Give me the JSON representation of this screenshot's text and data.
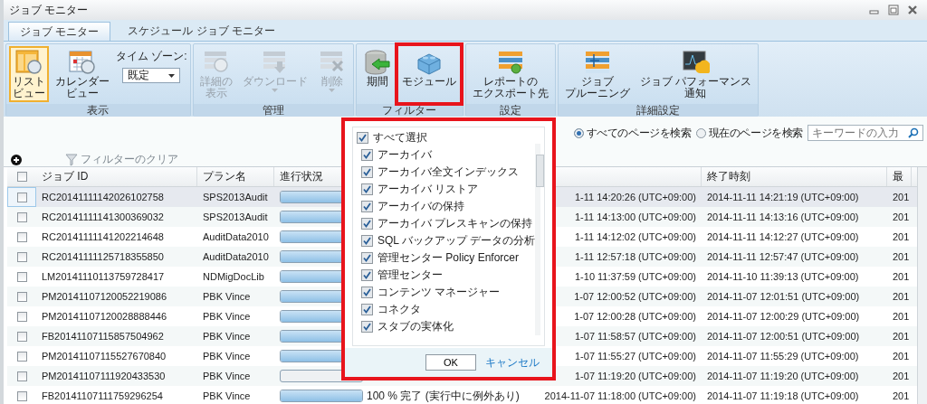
{
  "window": {
    "title": "ジョブ モニター"
  },
  "tabs": [
    {
      "label": "ジョブ モニター",
      "selected": true
    },
    {
      "label": "スケジュール ジョブ モニター",
      "selected": false
    }
  ],
  "ribbon": {
    "groups": [
      {
        "label": "表示",
        "items": [
          {
            "kind": "list-view",
            "lines": [
              "リスト",
              "ビュー"
            ],
            "selected": true
          },
          {
            "kind": "calendar-view",
            "lines": [
              "カレンダー",
              "ビュー"
            ],
            "selected": false
          },
          {
            "kind": "timezone",
            "label": "タイム ゾーン:",
            "value": "既定"
          }
        ]
      },
      {
        "label": "管理",
        "items": [
          {
            "kind": "details",
            "lines": [
              "詳細の",
              "表示"
            ],
            "disabled": true
          },
          {
            "kind": "download",
            "lines": [
              "ダウンロード"
            ],
            "disabled": true,
            "dropdown": true
          },
          {
            "kind": "delete",
            "lines": [
              "削除"
            ],
            "disabled": true,
            "dropdown": true
          }
        ]
      },
      {
        "label": "フィルター",
        "items": [
          {
            "kind": "period",
            "lines": [
              "期間"
            ],
            "disabled": false
          },
          {
            "kind": "module",
            "lines": [
              "モジュール"
            ],
            "disabled": false,
            "highlighted": true
          }
        ]
      },
      {
        "label": "設定",
        "items": [
          {
            "kind": "report-export",
            "lines": [
              "レポートの",
              "エクスポート先"
            ],
            "disabled": false
          }
        ]
      },
      {
        "label": "詳細設定",
        "items": [
          {
            "kind": "pruning",
            "lines": [
              "ジョブ",
              "プルーニング"
            ],
            "disabled": false
          },
          {
            "kind": "perf-notify",
            "lines": [
              "ジョブ パフォーマンス",
              "通知"
            ],
            "disabled": false
          }
        ]
      }
    ]
  },
  "search": {
    "scopes": [
      {
        "label": "すべてのページを検索",
        "selected": true
      },
      {
        "label": "現在のページを検索",
        "selected": false
      }
    ],
    "placeholder": "キーワードの入力"
  },
  "filter_clear": {
    "label": "フィルターのクリア",
    "disabled": true
  },
  "table": {
    "all_checked": false,
    "columns": {
      "job_id": "ジョブ ID",
      "plan": "プラン名",
      "progress": "進行状況",
      "end_time": "終了時刻",
      "column_7": "最"
    },
    "rows": [
      {
        "checked": false,
        "selected": true,
        "job_id": "RC20141111142026102758",
        "plan": "SPS2013Audit",
        "level": 1,
        "start_time": "1-11 14:20:26 (UTC+09:00)",
        "end_time": "2014-11-11 14:21:19 (UTC+09:00)",
        "column_7": "201"
      },
      {
        "checked": false,
        "selected": false,
        "job_id": "RC20141111141300369032",
        "plan": "SPS2013Audit",
        "level": 1,
        "start_time": "1-11 14:13:00 (UTC+09:00)",
        "end_time": "2014-11-11 14:13:16 (UTC+09:00)",
        "column_7": "201"
      },
      {
        "checked": false,
        "selected": false,
        "job_id": "RC20141111141202214648",
        "plan": "AuditData2010",
        "level": 1,
        "start_time": "1-11 14:12:02 (UTC+09:00)",
        "end_time": "2014-11-11 14:12:27 (UTC+09:00)",
        "column_7": "201"
      },
      {
        "checked": false,
        "selected": false,
        "job_id": "RC20141111125718355850",
        "plan": "AuditData2010",
        "level": 1,
        "start_time": "1-11 12:57:18 (UTC+09:00)",
        "end_time": "2014-11-11 12:57:47 (UTC+09:00)",
        "column_7": "201"
      },
      {
        "checked": false,
        "selected": false,
        "job_id": "LM20141110113759728417",
        "plan": "NDMigDocLib",
        "level": 1,
        "start_time": "1-10 11:37:59 (UTC+09:00)",
        "end_time": "2014-11-10 11:39:13 (UTC+09:00)",
        "column_7": "201"
      },
      {
        "checked": false,
        "selected": false,
        "job_id": "PM20141107120052219086",
        "plan": "PBK Vince",
        "level": 1,
        "start_time": "1-07 12:00:52 (UTC+09:00)",
        "end_time": "2014-11-07 12:01:51 (UTC+09:00)",
        "column_7": "201"
      },
      {
        "checked": false,
        "selected": false,
        "job_id": "PM20141107120028888446",
        "plan": "PBK Vince",
        "level": 1,
        "start_time": "1-07 12:00:28 (UTC+09:00)",
        "end_time": "2014-11-07 12:00:29 (UTC+09:00)",
        "column_7": "201"
      },
      {
        "checked": false,
        "selected": false,
        "job_id": "FB20141107115857504962",
        "plan": "PBK Vince",
        "level": 1,
        "start_time": "1-07 11:58:57 (UTC+09:00)",
        "end_time": "2014-11-07 12:00:51 (UTC+09:00)",
        "column_7": "201"
      },
      {
        "checked": false,
        "selected": false,
        "job_id": "PM20141107115527670840",
        "plan": "PBK Vince",
        "level": 1,
        "start_time": "1-07 11:55:27 (UTC+09:00)",
        "end_time": "2014-11-07 11:55:29 (UTC+09:00)",
        "column_7": "201"
      },
      {
        "checked": false,
        "selected": false,
        "job_id": "PM20141107111920433530",
        "plan": "PBK Vince",
        "level": 0,
        "start_time": "1-07 11:19:20 (UTC+09:00)",
        "end_time": "2014-11-07 11:19:20 (UTC+09:00)",
        "column_7": "201"
      },
      {
        "checked": false,
        "selected": false,
        "job_id": "FB20141107111759296254",
        "plan": "PBK Vince",
        "level": 1,
        "status": "100 % 完了 (実行中に例外あり)",
        "start_time": "2014-11-07 11:18:00 (UTC+09:00)",
        "end_time": "2014-11-07 11:19:18 (UTC+09:00)",
        "column_7": "201"
      }
    ]
  },
  "module_popup": {
    "highlighted": true,
    "select_all": {
      "label": "すべて選択",
      "checked": true
    },
    "items": [
      {
        "label": "アーカイバ",
        "checked": true
      },
      {
        "label": "アーカイバ全文インデックス",
        "checked": true
      },
      {
        "label": "アーカイバ リストア",
        "checked": true
      },
      {
        "label": "アーカイバの保持",
        "checked": true
      },
      {
        "label": "アーカイバ プレスキャンの保持",
        "checked": true
      },
      {
        "label": "SQL バックアップ データの分析",
        "checked": true
      },
      {
        "label": "管理センター Policy Enforcer",
        "checked": true
      },
      {
        "label": "管理センター",
        "checked": true
      },
      {
        "label": "コンテンツ マネージャー",
        "checked": true
      },
      {
        "label": "コネクタ",
        "checked": true
      },
      {
        "label": "スタブの実体化",
        "checked": true
      }
    ],
    "ok": "OK",
    "cancel": "キャンセル"
  }
}
